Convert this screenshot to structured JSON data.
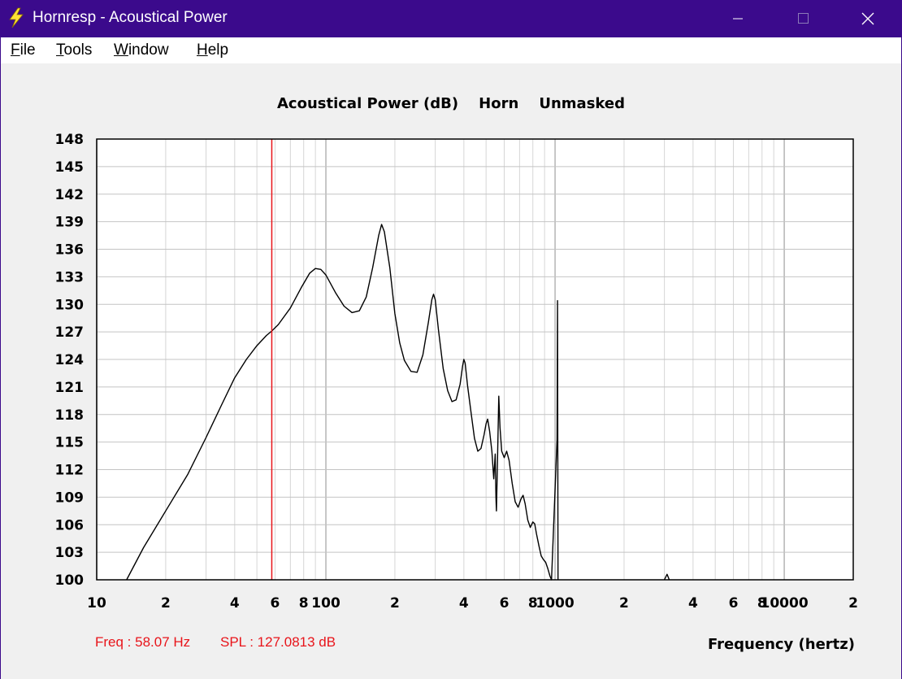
{
  "window": {
    "title": "Hornresp - Acoustical Power",
    "controls": [
      "minimize",
      "maximize",
      "close"
    ]
  },
  "menu": {
    "items": [
      {
        "access": "F",
        "rest": "ile"
      },
      {
        "access": "T",
        "rest": "ools"
      },
      {
        "access": "W",
        "rest": "indow"
      },
      {
        "access": "H",
        "rest": "elp"
      }
    ]
  },
  "readout": {
    "freq": "Freq : 58.07 Hz",
    "spl": "SPL : 127.0813 dB",
    "color": "#e8141a"
  },
  "chart_data": {
    "type": "line",
    "title": "Acoustical Power (dB)    Horn    Unmasked",
    "xlabel": "Frequency (hertz)",
    "ylabel": "",
    "x_scale": "log",
    "xlim": [
      10,
      20000
    ],
    "ylim": [
      100,
      148
    ],
    "grid": true,
    "y_ticks": [
      100,
      103,
      106,
      109,
      112,
      115,
      118,
      121,
      124,
      127,
      130,
      133,
      136,
      139,
      142,
      145,
      148
    ],
    "x_tick_labels": [
      {
        "x": 10,
        "label": "10"
      },
      {
        "x": 20,
        "label": "2"
      },
      {
        "x": 40,
        "label": "4"
      },
      {
        "x": 60,
        "label": "6"
      },
      {
        "x": 80,
        "label": "8"
      },
      {
        "x": 100,
        "label": "100"
      },
      {
        "x": 200,
        "label": "2"
      },
      {
        "x": 400,
        "label": "4"
      },
      {
        "x": 600,
        "label": "6"
      },
      {
        "x": 800,
        "label": "8"
      },
      {
        "x": 1000,
        "label": "1000"
      },
      {
        "x": 2000,
        "label": "2"
      },
      {
        "x": 4000,
        "label": "4"
      },
      {
        "x": 6000,
        "label": "6"
      },
      {
        "x": 8000,
        "label": "8"
      },
      {
        "x": 10000,
        "label": "10000"
      },
      {
        "x": 20000,
        "label": "2"
      }
    ],
    "cursor": {
      "freq": 58.07,
      "spl": 127.0813,
      "color": "#e8141a"
    },
    "series": [
      {
        "color": "#000000",
        "points": [
          [
            13.5,
            100
          ],
          [
            16,
            103.5
          ],
          [
            20,
            107.5
          ],
          [
            25,
            111.5
          ],
          [
            30,
            115.5
          ],
          [
            35,
            119
          ],
          [
            40,
            122
          ],
          [
            45,
            124
          ],
          [
            50,
            125.5
          ],
          [
            55,
            126.6
          ],
          [
            58.07,
            127.1
          ],
          [
            62,
            127.8
          ],
          [
            70,
            129.6
          ],
          [
            78,
            131.8
          ],
          [
            85,
            133.4
          ],
          [
            90,
            133.9
          ],
          [
            95,
            133.8
          ],
          [
            100,
            133.2
          ],
          [
            110,
            131.3
          ],
          [
            120,
            129.8
          ],
          [
            130,
            129.1
          ],
          [
            140,
            129.3
          ],
          [
            150,
            130.8
          ],
          [
            160,
            134
          ],
          [
            170,
            137.5
          ],
          [
            175,
            138.7
          ],
          [
            180,
            137.9
          ],
          [
            190,
            134
          ],
          [
            200,
            129
          ],
          [
            210,
            125.8
          ],
          [
            220,
            123.9
          ],
          [
            235,
            122.7
          ],
          [
            250,
            122.6
          ],
          [
            265,
            124.5
          ],
          [
            280,
            128
          ],
          [
            290,
            130.5
          ],
          [
            295,
            131.1
          ],
          [
            300,
            130.5
          ],
          [
            310,
            127.2
          ],
          [
            325,
            123
          ],
          [
            340,
            120.6
          ],
          [
            355,
            119.4
          ],
          [
            370,
            119.6
          ],
          [
            385,
            121.3
          ],
          [
            395,
            123.3
          ],
          [
            400,
            124
          ],
          [
            405,
            123.6
          ],
          [
            415,
            121.2
          ],
          [
            430,
            118.2
          ],
          [
            445,
            115.4
          ],
          [
            460,
            114
          ],
          [
            475,
            114.3
          ],
          [
            490,
            115.8
          ],
          [
            500,
            117
          ],
          [
            508,
            117.5
          ],
          [
            518,
            116.2
          ],
          [
            530,
            114
          ],
          [
            540,
            111
          ],
          [
            548,
            113.7
          ],
          [
            552,
            109
          ],
          [
            555,
            107.5
          ],
          [
            560,
            112
          ],
          [
            568,
            120
          ],
          [
            575,
            116.6
          ],
          [
            585,
            114
          ],
          [
            600,
            113.3
          ],
          [
            615,
            114
          ],
          [
            630,
            113
          ],
          [
            650,
            110.5
          ],
          [
            670,
            108.5
          ],
          [
            690,
            107.9
          ],
          [
            710,
            108.8
          ],
          [
            725,
            109.2
          ],
          [
            740,
            108.3
          ],
          [
            760,
            106.5
          ],
          [
            780,
            105.7
          ],
          [
            800,
            106.3
          ],
          [
            815,
            106.1
          ],
          [
            830,
            105
          ],
          [
            850,
            103.7
          ],
          [
            870,
            102.6
          ],
          [
            890,
            102.2
          ],
          [
            910,
            101.9
          ],
          [
            930,
            101.2
          ],
          [
            950,
            100.4
          ],
          [
            965,
            100
          ],
          [
            1020,
            115.3
          ],
          [
            1025,
            130.4
          ],
          [
            1030,
            100
          ]
        ]
      },
      {
        "color": "#000000",
        "points": [
          [
            3000,
            100
          ],
          [
            3080,
            100.6
          ],
          [
            3150,
            100
          ]
        ]
      }
    ]
  }
}
